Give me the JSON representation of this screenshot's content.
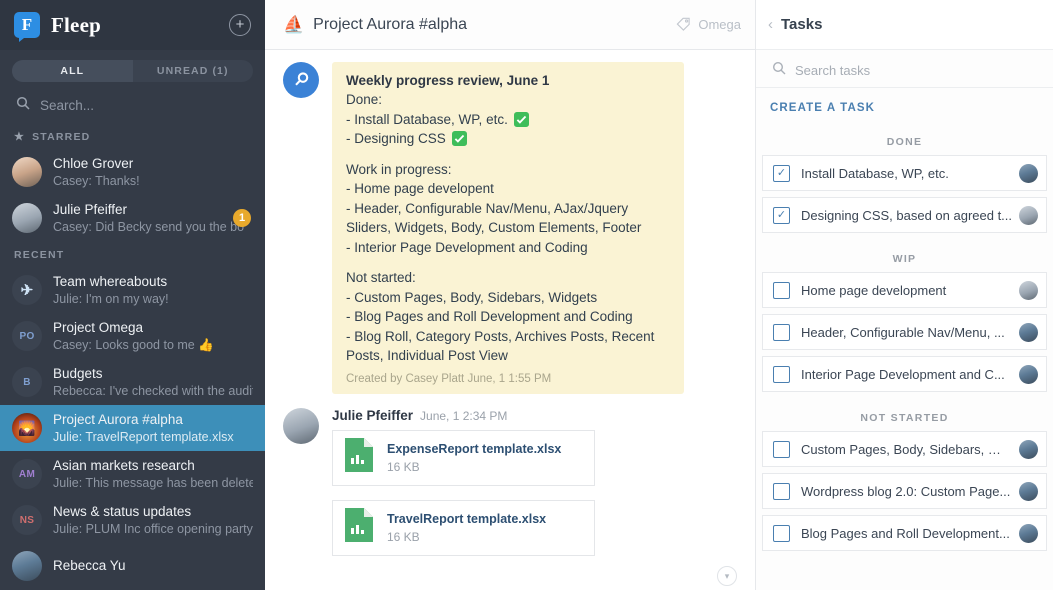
{
  "sidebar": {
    "brand": "Fleep",
    "add_button_icon": "plus-circle-icon",
    "filters": [
      {
        "label": "ALL",
        "active": true
      },
      {
        "label": "UNREAD (1)",
        "active": false
      }
    ],
    "search": {
      "placeholder": "Search...",
      "icon": "search-icon"
    },
    "sections": [
      {
        "label": "STARRED",
        "icon": "star-icon"
      },
      {
        "label": "RECENT",
        "icon": ""
      }
    ],
    "starred": [
      {
        "title": "Chloe Grover",
        "preview": "Casey: Thanks!",
        "avatar_class": "avB",
        "avatar_initials": "",
        "badge": ""
      },
      {
        "title": "Julie Pfeiffer",
        "preview": "Casey: Did Becky send you the bo",
        "avatar_class": "avC",
        "avatar_initials": "",
        "badge": "1"
      }
    ],
    "recent": [
      {
        "title": "Team whereabouts",
        "preview": "Julie: I'm on my way!",
        "avatar_class": "avPlane",
        "avatar_initials": "✈",
        "badge": "",
        "selected": false
      },
      {
        "title": "Project Omega",
        "preview": "Casey: Looks good to me 👍",
        "avatar_class": "avPO",
        "avatar_initials": "PO",
        "badge": "",
        "selected": false
      },
      {
        "title": "Budgets",
        "preview": "Rebecca: I've checked with the audito",
        "avatar_class": "avB2",
        "avatar_initials": "B",
        "badge": "",
        "selected": false
      },
      {
        "title": "Project Aurora #alpha",
        "preview": "Julie: TravelReport template.xlsx",
        "avatar_class": "avAurora",
        "avatar_initials": "🌄",
        "badge": "",
        "selected": true
      },
      {
        "title": "Asian markets research",
        "preview": "Julie: This message has been deleted",
        "avatar_class": "avAM",
        "avatar_initials": "AM",
        "badge": "",
        "selected": false
      },
      {
        "title": "News & status updates",
        "preview": "Julie: PLUM Inc office opening party 🎉",
        "avatar_class": "avNS",
        "avatar_initials": "NS",
        "badge": "",
        "selected": false
      },
      {
        "title": "Rebecca Yu",
        "preview": "",
        "avatar_class": "avA",
        "avatar_initials": "",
        "badge": "",
        "selected": false
      }
    ]
  },
  "conversation": {
    "header": {
      "emoji": "⛵",
      "title": "Project Aurora #alpha",
      "tag_icon": "tag-icon",
      "tag_label": "Omega"
    },
    "pinned_message": {
      "avatar_icon": "search-pin-avatar",
      "title": "Weekly progress review, June 1",
      "blocks": [
        {
          "lines": [
            {
              "text": "Done:",
              "check": false
            },
            {
              "text": "- Install Database, WP, etc.",
              "check": true
            },
            {
              "text": "- Designing CSS",
              "check": true
            }
          ]
        },
        {
          "lines": [
            {
              "text": "Work in progress:",
              "check": false
            },
            {
              "text": "- Home page developent",
              "check": false
            },
            {
              "text": "- Header, Configurable Nav/Menu, AJax/Jquery Sliders, Widgets, Body, Custom Elements, Footer",
              "check": false
            },
            {
              "text": "- Interior Page Development and Coding",
              "check": false
            }
          ]
        },
        {
          "lines": [
            {
              "text": "Not started:",
              "check": false
            },
            {
              "text": "- Custom Pages, Body, Sidebars, Widgets",
              "check": false
            },
            {
              "text": "- Blog Pages and Roll Development and Coding",
              "check": false
            },
            {
              "text": "- Blog Roll, Category Posts, Archives Posts, Recent Posts, Individual Post View",
              "check": false
            }
          ]
        }
      ],
      "footer": "Created by Casey Platt June, 1 1:55 PM"
    },
    "message": {
      "author": "Julie Pfeiffer",
      "time": "June, 1 2:34 PM",
      "avatar_class": "avC",
      "attachments": [
        {
          "name": "ExpenseReport template.xlsx",
          "size": "16 KB",
          "icon": "spreadsheet-file-icon"
        },
        {
          "name": "TravelReport template.xlsx",
          "size": "16 KB",
          "icon": "spreadsheet-file-icon"
        }
      ]
    },
    "scroll_down_icon": "chevron-down-circle-icon"
  },
  "tasks_panel": {
    "back_icon": "chevron-left-icon",
    "title": "Tasks",
    "search": {
      "placeholder": "Search tasks",
      "icon": "search-icon"
    },
    "create_label": "CREATE A TASK",
    "groups": [
      {
        "label": "DONE",
        "items": [
          {
            "label": "Install Database, WP, etc.",
            "checked": true,
            "avatar_class": "avA"
          },
          {
            "label": "Designing CSS, based on agreed t...",
            "checked": true,
            "avatar_class": "avC"
          }
        ]
      },
      {
        "label": "WIP",
        "items": [
          {
            "label": "Home page development",
            "checked": false,
            "avatar_class": "avC"
          },
          {
            "label": "Header, Configurable Nav/Menu, ...",
            "checked": false,
            "avatar_class": "avA"
          },
          {
            "label": "Interior Page Development and C...",
            "checked": false,
            "avatar_class": "avA"
          }
        ]
      },
      {
        "label": "NOT STARTED",
        "items": [
          {
            "label": "Custom Pages, Body, Sidebars, Wi...",
            "checked": false,
            "avatar_class": "avA"
          },
          {
            "label": "Wordpress blog 2.0: Custom Page...",
            "checked": false,
            "avatar_class": "avA"
          },
          {
            "label": "Blog Pages and Roll Development...",
            "checked": false,
            "avatar_class": "avA"
          }
        ]
      }
    ],
    "checkmark_glyph": "✓"
  },
  "colors": {
    "sidebar_bg": "#343b47",
    "sidebar_header_bg": "#2f3641",
    "selected_convo": "#3d8fb9",
    "badge": "#e8a92c",
    "bubble_bg": "#faf3d4",
    "accent_blue": "#4a7fb0",
    "brand_blue": "#2d8ee3",
    "file_green": "#4caf6f"
  }
}
